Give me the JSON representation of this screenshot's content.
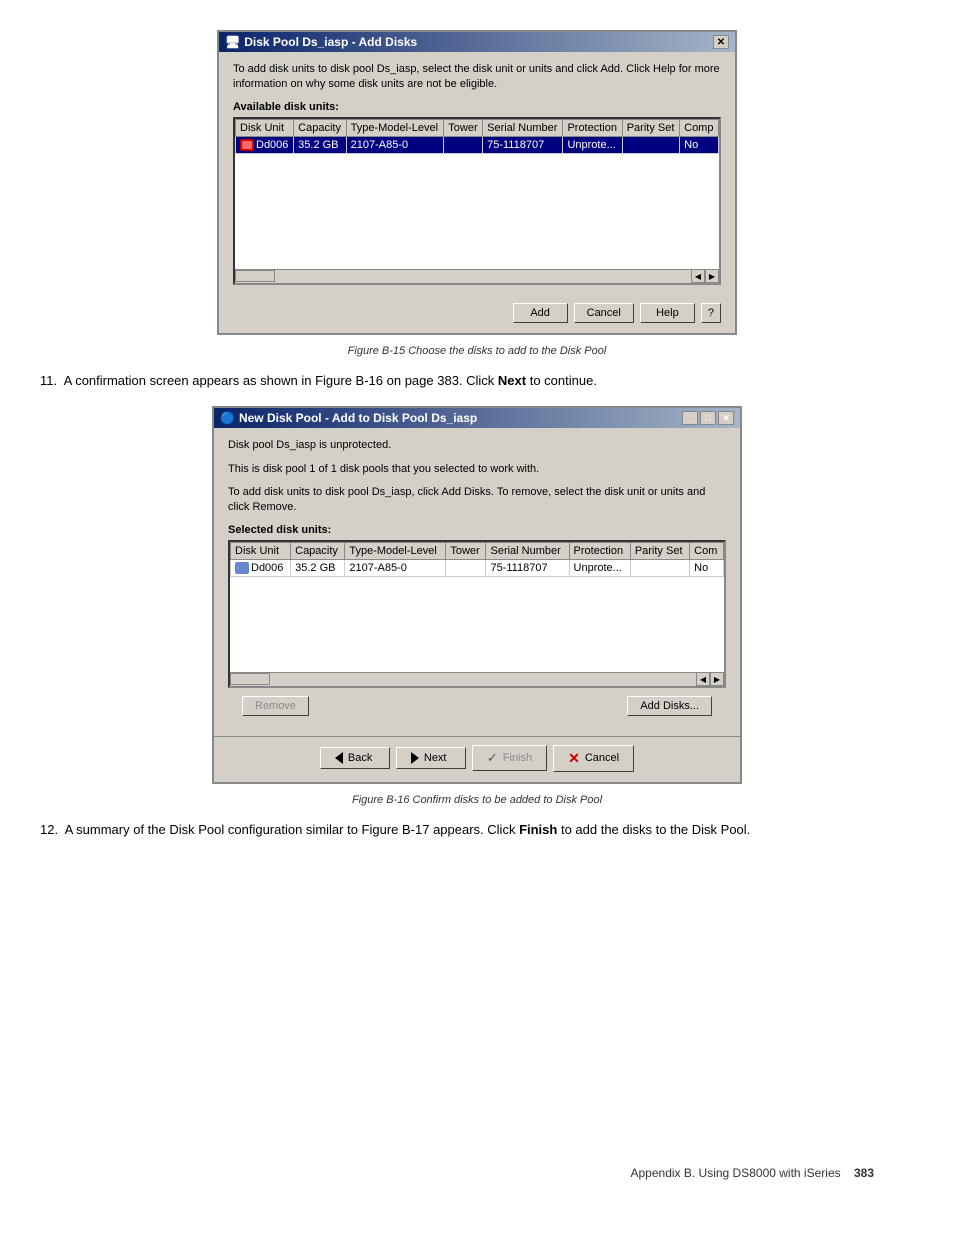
{
  "dialog1": {
    "title": "Disk Pool Ds_iasp - Add Disks",
    "description": "To add disk units to disk pool Ds_iasp, select the disk unit or units and click Add. Click Help for more information on why some disk units are not be eligible.",
    "section_label": "Available disk units:",
    "table": {
      "columns": [
        "Disk Unit",
        "Capacity",
        "Type-Model-Level",
        "Tower",
        "Serial Number",
        "Protection",
        "Parity Set",
        "Comp"
      ],
      "rows": [
        [
          "Dd006",
          "35.2 GB",
          "2107-A85-0",
          "",
          "75-1118707",
          "Unprote...",
          "",
          "No"
        ]
      ]
    },
    "buttons": {
      "add": "Add",
      "cancel": "Cancel",
      "help": "Help",
      "question": "?"
    }
  },
  "figure1": {
    "caption": "Figure B-15   Choose the disks to add to the Disk Pool"
  },
  "step11": {
    "number": "11.",
    "text": "A confirmation screen appears as shown in Figure B-16 on page 383. Click ",
    "bold": "Next",
    "text2": " to continue."
  },
  "dialog2": {
    "title": "New Disk Pool - Add to Disk Pool Ds_iasp",
    "line1": "Disk pool Ds_iasp is unprotected.",
    "line2": "This is disk pool 1 of 1 disk pools that you selected to work with.",
    "line3": "To add disk units to disk pool Ds_iasp, click Add Disks. To remove, select the disk unit or units and click Remove.",
    "section_label": "Selected disk units:",
    "table": {
      "columns": [
        "Disk Unit",
        "Capacity",
        "Type-Model-Level",
        "Tower",
        "Serial Number",
        "Protection",
        "Parity Set",
        "Com"
      ],
      "rows": [
        [
          "Dd006",
          "35.2 GB",
          "2107-A85-0",
          "",
          "75-1118707",
          "Unprote...",
          "",
          "No"
        ]
      ]
    },
    "buttons": {
      "remove": "Remove",
      "add_disks": "Add Disks...",
      "back": "Back",
      "next": "Next",
      "finish": "Finish",
      "cancel": "Cancel"
    }
  },
  "figure2": {
    "caption": "Figure B-16   Confirm disks to be added to Disk Pool"
  },
  "step12": {
    "number": "12.",
    "text": "A summary of the Disk Pool configuration similar to Figure B-17 appears. Click ",
    "bold": "Finish",
    "text2": " to add the disks to the Disk Pool."
  },
  "page_footer": {
    "left": "Appendix B. Using DS8000 with iSeries",
    "right": "383"
  }
}
